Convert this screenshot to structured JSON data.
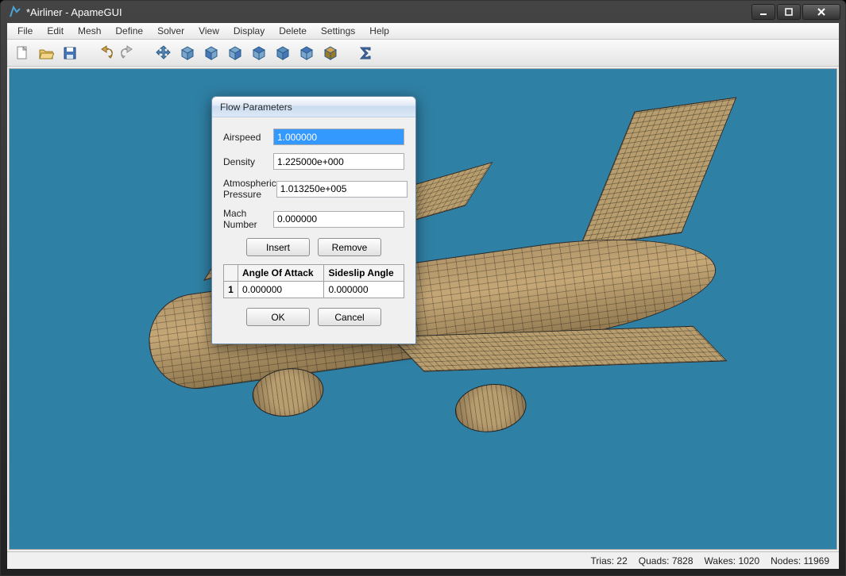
{
  "window": {
    "title": "*Airliner - ApameGUI"
  },
  "menubar": {
    "items": [
      "File",
      "Edit",
      "Mesh",
      "Define",
      "Solver",
      "View",
      "Display",
      "Delete",
      "Settings",
      "Help"
    ]
  },
  "toolbar": {
    "icons": [
      "new-file-icon",
      "open-file-icon",
      "save-file-icon",
      "undo-icon",
      "redo-icon",
      "move-icon",
      "view-iso-icon",
      "view-front-icon",
      "view-back-icon",
      "view-left-icon",
      "view-right-icon",
      "view-top-icon",
      "view-bottom-icon",
      "sigma-icon"
    ]
  },
  "statusbar": {
    "trias_label": "Trias:",
    "trias": "22",
    "quads_label": "Quads:",
    "quads": "7828",
    "wakes_label": "Wakes:",
    "wakes": "1020",
    "nodes_label": "Nodes:",
    "nodes": "11969"
  },
  "dialog": {
    "title": "Flow Parameters",
    "fields": {
      "airspeed_label": "Airspeed",
      "airspeed": "1.000000",
      "density_label": "Density",
      "density": "1.225000e+000",
      "pressure_label": "Atmospheric Pressure",
      "pressure": "1.013250e+005",
      "mach_label": "Mach Number",
      "mach": "0.000000"
    },
    "buttons": {
      "insert": "Insert",
      "remove": "Remove",
      "ok": "OK",
      "cancel": "Cancel"
    },
    "table": {
      "col1": "Angle Of Attack",
      "col2": "Sideslip Angle",
      "row1num": "1",
      "row1col1": "0.000000",
      "row1col2": "0.000000"
    }
  }
}
